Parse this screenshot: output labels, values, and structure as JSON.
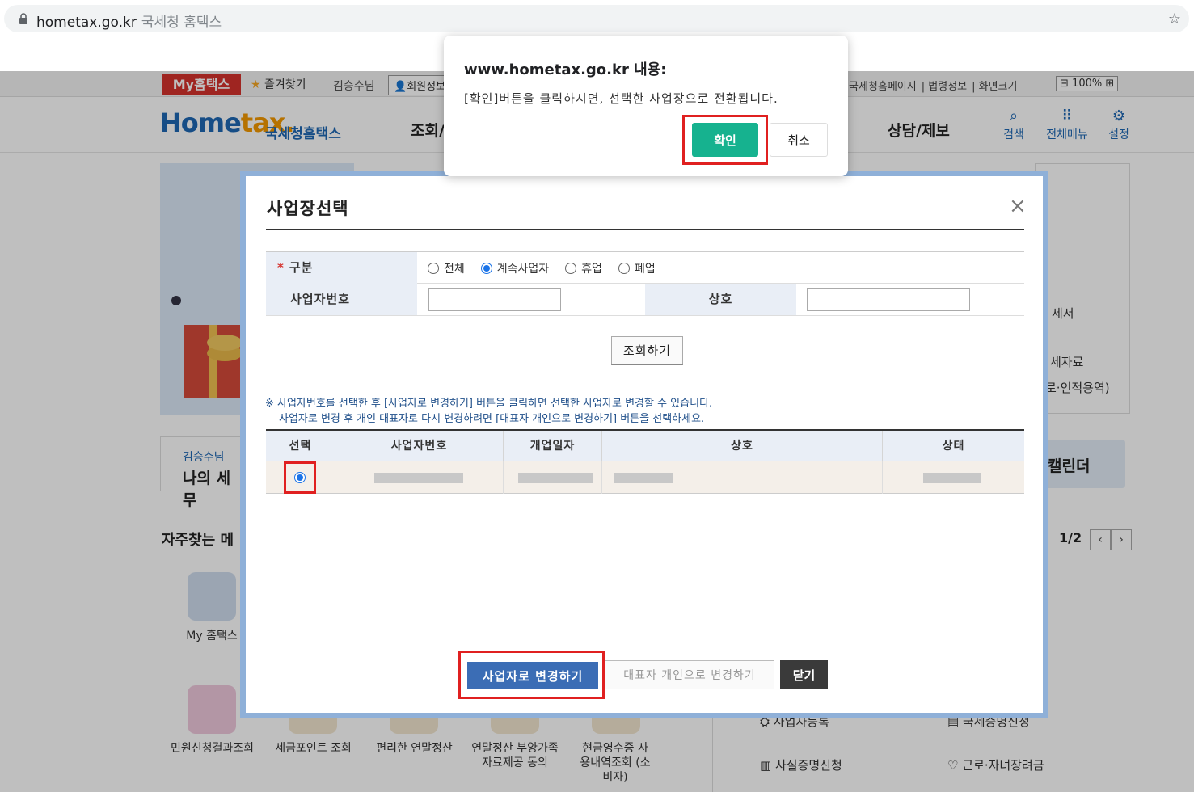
{
  "browser": {
    "url": "hometax.go.kr",
    "tab_title": "국세청 홈택스"
  },
  "site": {
    "my_badge": "My홈택스",
    "favorites": "즐겨찾기",
    "user_name": "김승수님",
    "member_info": "회원정보",
    "right_links": [
      "국세청홈페이지",
      "법령정보",
      "화면크기"
    ],
    "zoom": "100%",
    "logo_main": "Home",
    "logo_tax": "tax.",
    "logo_sub": "국세청홈택스",
    "nav_left": "조회/",
    "nav_right": "상담/제보",
    "header_icons": [
      {
        "label": "검색",
        "icon": "search-icon"
      },
      {
        "label": "전체메뉴",
        "icon": "grid-menu-icon"
      },
      {
        "label": "설정",
        "icon": "gear-icon"
      }
    ],
    "right_panel_texts": [
      "세서",
      "세자료",
      "로·인적용역)"
    ],
    "mytax_small": "김승수님",
    "mytax_big": "나의 세무",
    "calendar": "캘린더",
    "freq_title": "자주찾는 메",
    "pager": "1/2",
    "quick_menu": [
      {
        "label": "My 홈택스"
      },
      {
        "label": "민원신청결과조회"
      },
      {
        "label": "세금포인트 조회"
      },
      {
        "label": "편리한 연말정산"
      },
      {
        "label": "연말정산 부양가족 자료제공 동의"
      },
      {
        "label": "현금영수증 사용내역조회 (소비자)"
      }
    ],
    "right_menu": [
      "사업자등록",
      "국세증명신청",
      "사실증명신청",
      "근로·자녀장려금"
    ]
  },
  "modal": {
    "title": "사업장선택",
    "close": "×",
    "form": {
      "type_label": "구분",
      "radio_options": [
        {
          "label": "전체",
          "checked": false
        },
        {
          "label": "계속사업자",
          "checked": true
        },
        {
          "label": "휴업",
          "checked": false
        },
        {
          "label": "폐업",
          "checked": false
        }
      ],
      "bizno_label": "사업자번호",
      "bizno_value": "",
      "name_label": "상호",
      "name_value": ""
    },
    "search_button": "조회하기",
    "notice_line1": "※ 사업자번호를 선택한 후 [사업자로 변경하기] 버튼을 클릭하면 선택한 사업자로 변경할 수 있습니다.",
    "notice_line2": "사업자로 변경 후 개인 대표자로 다시 변경하려면 [대표자 개인으로 변경하기] 버튼을 선택하세요.",
    "table": {
      "headers": [
        "선택",
        "사업자번호",
        "개업일자",
        "상호",
        "상태"
      ],
      "rows": [
        {
          "selected": true,
          "bizno": "",
          "open_date": "",
          "name": "",
          "status": ""
        }
      ]
    },
    "btn_change": "사업자로 변경하기",
    "btn_personal": "대표자 개인으로 변경하기",
    "btn_close": "닫기"
  },
  "confirm": {
    "title": "www.hometax.go.kr 내용:",
    "message": "[확인]버튼을 클릭하시면, 선택한 사업장으로 전환됩니다.",
    "ok": "확인",
    "cancel": "취소"
  },
  "colors": {
    "accent_red": "#e02020",
    "ok_green": "#16b28f",
    "primary_blue": "#3b6db5",
    "header_blue": "#1e67b3"
  }
}
